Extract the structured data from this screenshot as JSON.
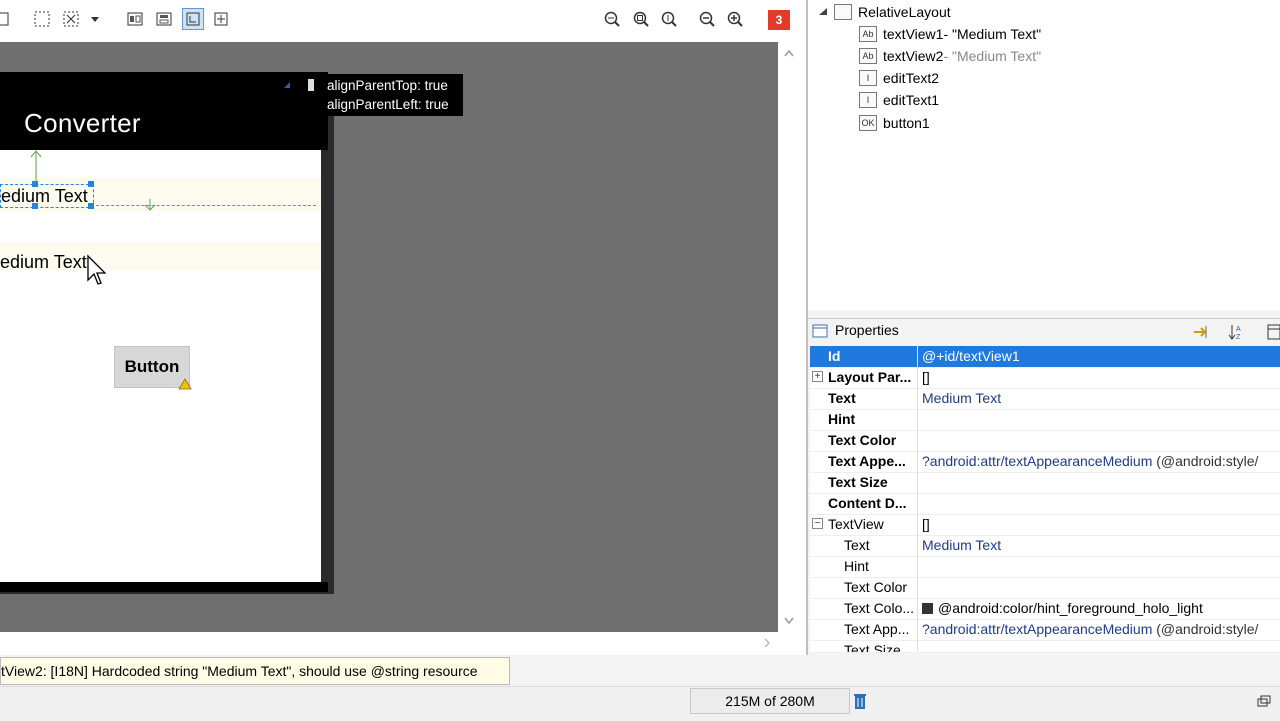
{
  "device": {
    "app_title": "Converter",
    "text_view1": "edium Text",
    "text_view2": "edium Text",
    "button_label": "Button"
  },
  "tooltip": {
    "line1": "alignParentTop: true",
    "line2": "alignParentLeft: true"
  },
  "toolbar": {
    "warning_count": "3"
  },
  "outline": {
    "root": "RelativeLayout",
    "items": [
      {
        "name": "textView1",
        "sub": " - \"Medium Text\"",
        "icon": "Ab"
      },
      {
        "name": "textView2",
        "sub": " - \"Medium Text\"",
        "icon": "Ab"
      },
      {
        "name": "editText2",
        "sub": "",
        "icon": "I"
      },
      {
        "name": "editText1",
        "sub": "",
        "icon": "I"
      },
      {
        "name": "button1",
        "sub": "",
        "icon": "OK"
      }
    ]
  },
  "properties": {
    "title": "Properties",
    "rows": [
      {
        "name": "Id",
        "value": "@+id/textView1"
      },
      {
        "name": "Layout Par...",
        "value": "[]"
      },
      {
        "name": "Text",
        "value": "Medium Text"
      },
      {
        "name": "Hint",
        "value": ""
      },
      {
        "name": "Text Color",
        "value": ""
      },
      {
        "name": "Text Appe...",
        "value": "?android:attr/textAppearanceMedium",
        "extra": " (@android:style/"
      },
      {
        "name": "Text Size",
        "value": ""
      },
      {
        "name": "Content D...",
        "value": ""
      },
      {
        "name": "TextView",
        "value": "[]"
      },
      {
        "name": "Text",
        "value": "Medium Text"
      },
      {
        "name": "Hint",
        "value": ""
      },
      {
        "name": "Text Color",
        "value": ""
      },
      {
        "name": "Text Colo...",
        "value": "@android:color/hint_foreground_holo_light"
      },
      {
        "name": "Text App...",
        "value": "?android:attr/textAppearanceMedium",
        "extra": " (@android:style/"
      },
      {
        "name": "Text Size",
        "value": ""
      }
    ]
  },
  "problem": {
    "message": "tView2: [I18N] Hardcoded string \"Medium Text\", should use @string resource"
  },
  "status": {
    "heap": "215M of 280M"
  },
  "colors": {
    "selection": "#1f7ae0",
    "warning_badge": "#e23b2e",
    "canvas": "#6f6f6f"
  }
}
